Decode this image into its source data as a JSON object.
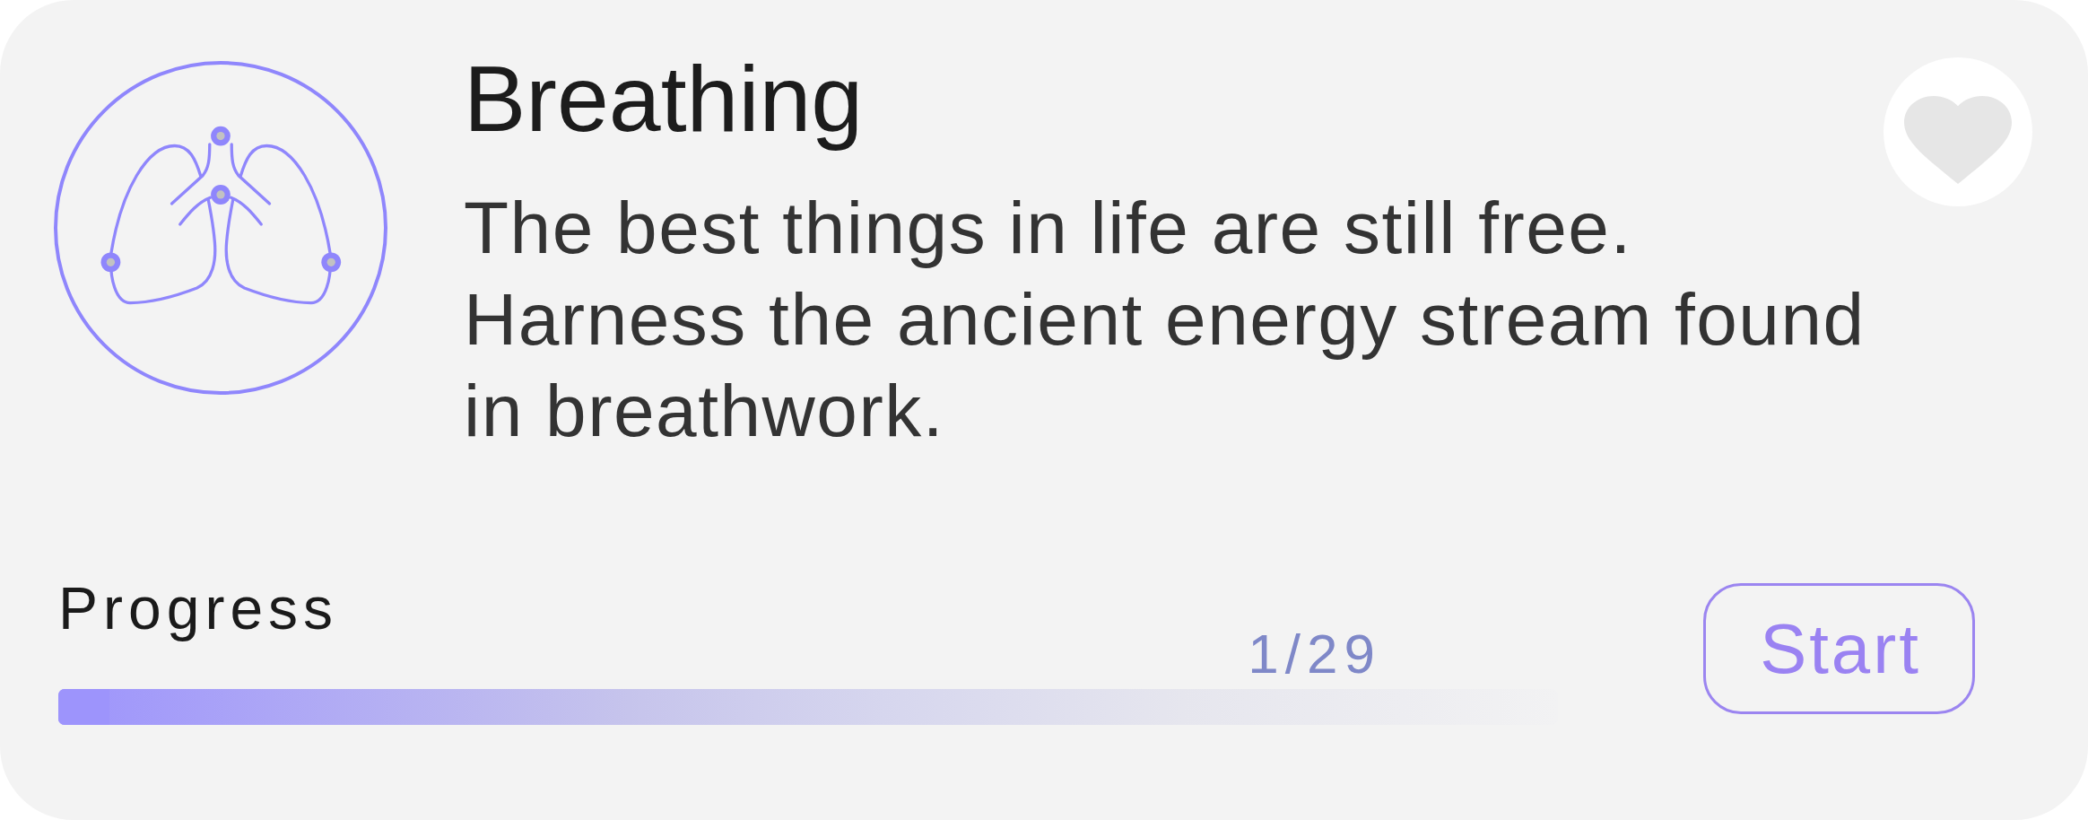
{
  "card": {
    "title": "Breathing",
    "description": "The best things in life are still free. Harness the ancient energy stream found in breathwork.",
    "favorited": false
  },
  "progress": {
    "label": "Progress",
    "count": "1/29",
    "level": 0.034
  },
  "start_button": {
    "label": "Start"
  }
}
